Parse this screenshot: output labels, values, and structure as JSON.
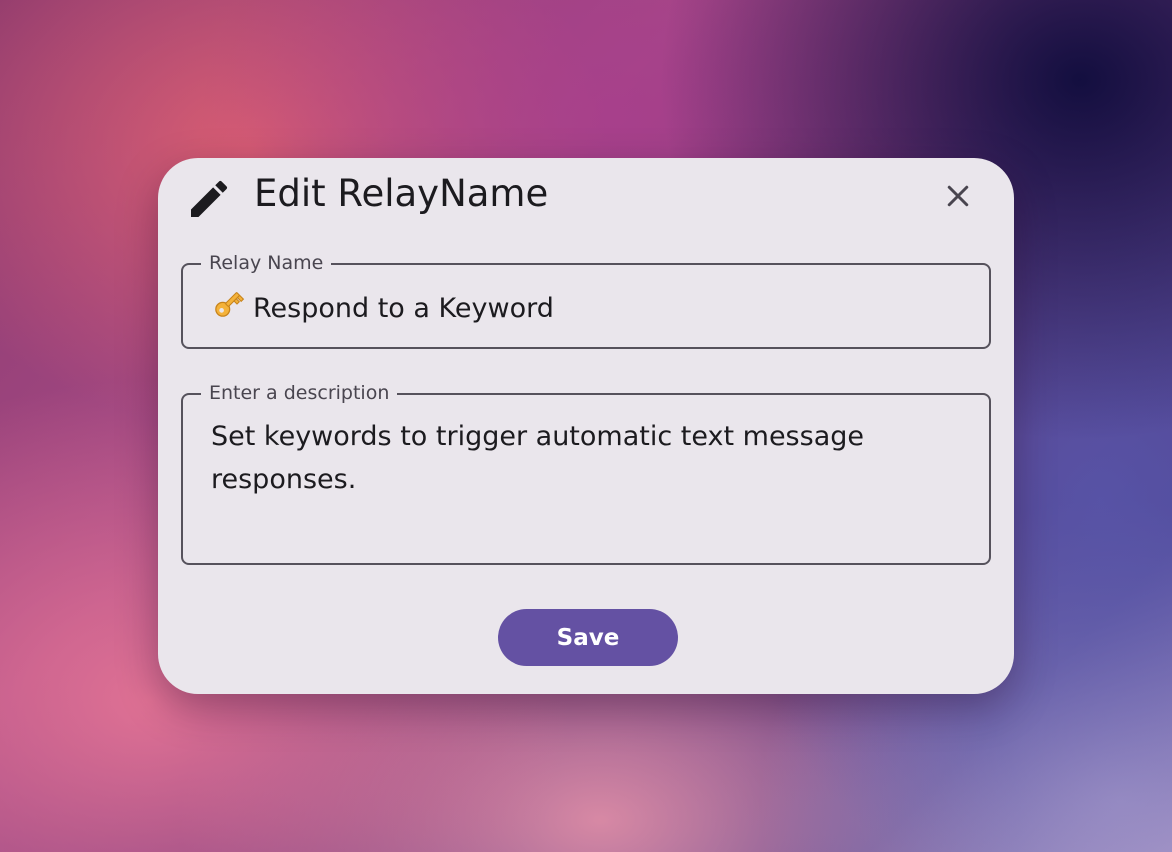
{
  "dialog": {
    "title": "Edit RelayName",
    "title_icon": "pencil-icon",
    "close_icon": "close-icon"
  },
  "fields": {
    "relay_name": {
      "label": "Relay Name",
      "icon": "key-emoji-icon",
      "value": "Respond to a Keyword"
    },
    "description": {
      "label": "Enter a description",
      "value": "Set keywords to trigger automatic text message responses."
    }
  },
  "actions": {
    "save_label": "Save"
  },
  "colors": {
    "dialog_bg": "#eae6ec",
    "primary": "#6451a3",
    "text": "#1c1b1f",
    "outline": "#56525c"
  }
}
